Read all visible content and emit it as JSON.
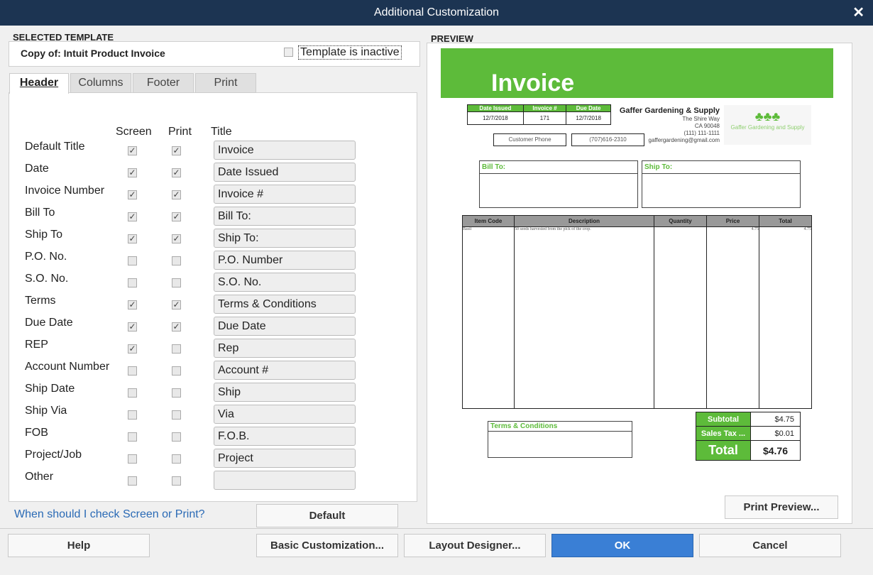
{
  "window": {
    "title": "Additional Customization",
    "close": "✕"
  },
  "selected_template": {
    "heading": "SELECTED TEMPLATE",
    "name": "Copy of: Intuit Product Invoice",
    "inactive_label": "Template is inactive",
    "inactive": false
  },
  "tabs": [
    {
      "label": "Header",
      "active": true
    },
    {
      "label": "Columns"
    },
    {
      "label": "Footer"
    },
    {
      "label": "Print"
    }
  ],
  "columns": {
    "screen": "Screen",
    "print": "Print",
    "title": "Title"
  },
  "rows": [
    {
      "label": "Default Title",
      "screen": true,
      "print": true,
      "title": "Invoice"
    },
    {
      "label": "Date",
      "screen": true,
      "print": true,
      "title": "Date Issued"
    },
    {
      "label": "Invoice Number",
      "screen": true,
      "print": true,
      "title": "Invoice #"
    },
    {
      "label": "Bill To",
      "screen": true,
      "print": true,
      "title": "Bill To:"
    },
    {
      "label": "Ship To",
      "screen": true,
      "print": true,
      "title": "Ship To:"
    },
    {
      "label": "P.O. No.",
      "screen": false,
      "print": false,
      "title": "P.O. Number"
    },
    {
      "label": "S.O. No.",
      "screen": false,
      "print": false,
      "title": "S.O. No."
    },
    {
      "label": "Terms",
      "screen": true,
      "print": true,
      "title": "Terms & Conditions"
    },
    {
      "label": "Due Date",
      "screen": true,
      "print": true,
      "title": "Due Date"
    },
    {
      "label": "REP",
      "screen": true,
      "print": false,
      "title": "Rep"
    },
    {
      "label": "Account Number",
      "screen": false,
      "print": false,
      "title": "Account #"
    },
    {
      "label": "Ship Date",
      "screen": false,
      "print": false,
      "title": "Ship"
    },
    {
      "label": "Ship Via",
      "screen": false,
      "print": false,
      "title": "Via"
    },
    {
      "label": "FOB",
      "screen": false,
      "print": false,
      "title": "F.O.B."
    },
    {
      "label": "Project/Job",
      "screen": false,
      "print": false,
      "title": "Project"
    },
    {
      "label": "Other",
      "screen": false,
      "print": false,
      "title": ""
    }
  ],
  "help_link": "When should I check Screen or Print?",
  "default_button": "Default",
  "preview": {
    "heading": "PREVIEW",
    "invoice_title": "Invoice",
    "accent": "#5dbb3a",
    "info_headers": [
      "Date Issued",
      "Invoice #",
      "Due Date"
    ],
    "info_values": [
      "12/7/2018",
      "171",
      "12/7/2018"
    ],
    "customer_phone_label": "Customer Phone",
    "customer_phone": "(707)616-2310",
    "company": {
      "name": "Gaffer Gardening & Supply",
      "address1": "The Shire Way",
      "address2": "CA 90048",
      "phone": "(111) 111-1111",
      "email": "gaffergardening@gmail.com",
      "logo_text": "Gaffer Gardening and Supply"
    },
    "bill_to": "Bill To:",
    "ship_to": "Ship To:",
    "table_headers": [
      "Item Code",
      "Description",
      "Quantity",
      "Price",
      "Total"
    ],
    "table_rows": [
      [
        "Basil",
        "50 seeds harvested from the pick of the crop.",
        "",
        "4.75",
        "4.75"
      ]
    ],
    "terms": "Terms & Conditions",
    "subtotal_label": "Subtotal",
    "subtotal": "$4.75",
    "tax_label": "Sales Tax ...",
    "tax": "$0.01",
    "total_label": "Total",
    "total": "$4.76",
    "print_preview_button": "Print Preview..."
  },
  "footer": {
    "help": "Help",
    "basic": "Basic Customization...",
    "layout": "Layout Designer...",
    "ok": "OK",
    "cancel": "Cancel"
  }
}
